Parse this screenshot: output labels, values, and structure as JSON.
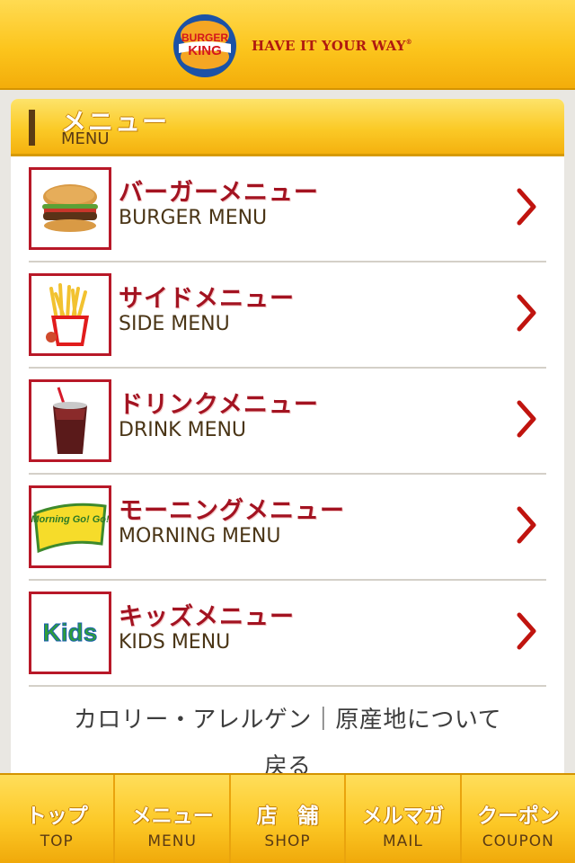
{
  "header": {
    "logo_line1": "BURGER",
    "logo_line2": "KING",
    "tagline": "HAVE IT YOUR WAY",
    "tagline_mark": "®"
  },
  "section": {
    "title": "メニュー",
    "subtitle": "MENU"
  },
  "menu": {
    "items": [
      {
        "title": "バーガーメニュー",
        "subtitle": "BURGER MENU",
        "icon": "burger-image"
      },
      {
        "title": "サイドメニュー",
        "subtitle": "SIDE MENU",
        "icon": "fries-image"
      },
      {
        "title": "ドリンクメニュー",
        "subtitle": "DRINK MENU",
        "icon": "drink-image"
      },
      {
        "title": "モーニングメニュー",
        "subtitle": "MORNING MENU",
        "icon": "morning-logo"
      },
      {
        "title": "キッズメニュー",
        "subtitle": "KIDS MENU",
        "icon": "kids-logo"
      }
    ]
  },
  "links": {
    "calorie": "カロリー・アレルゲン",
    "separator": "｜",
    "origin": "原産地について",
    "back": "戻る"
  },
  "morning_logo_text": "Morning Go! Go!",
  "kids_logo_text": "Kids",
  "nav": {
    "items": [
      {
        "jp": "トップ",
        "en": "TOP"
      },
      {
        "jp": "メニュー",
        "en": "MENU"
      },
      {
        "jp": "店　舗",
        "en": "SHOP"
      },
      {
        "jp": "メルマガ",
        "en": "MAIL"
      },
      {
        "jp": "クーポン",
        "en": "COUPON"
      }
    ]
  },
  "colors": {
    "accent_red": "#a31321",
    "header_yellow": "#fcc51d",
    "brown": "#5b3b14",
    "chevron_red": "#c0140f"
  }
}
